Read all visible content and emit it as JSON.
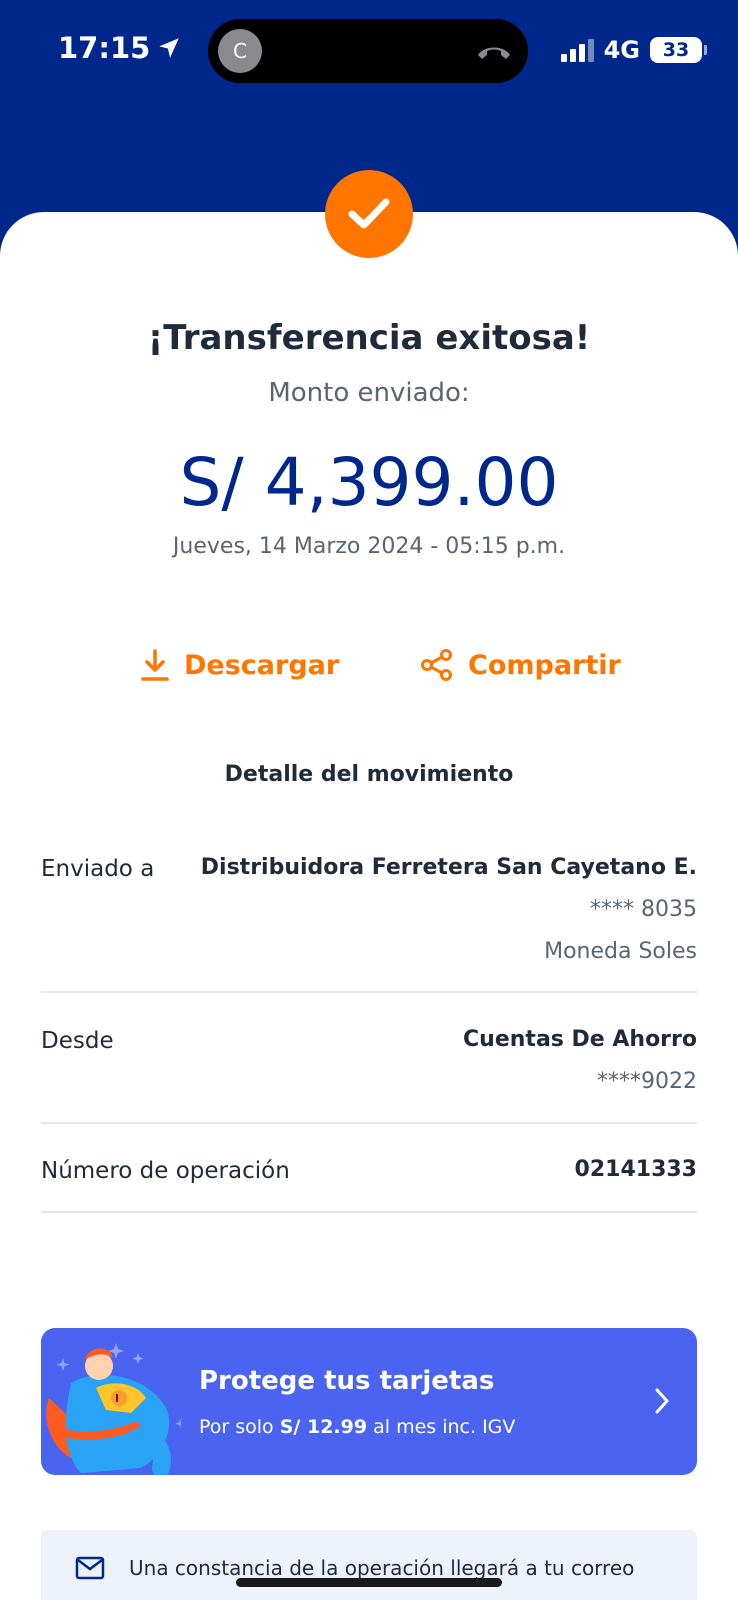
{
  "status_bar": {
    "time": "17:15",
    "caller_initial": "C",
    "network": "4G",
    "battery": "33"
  },
  "colors": {
    "brand_blue": "#00288c",
    "accent_orange": "#ff7500",
    "promo_blue": "#4a63f0"
  },
  "header": {
    "title": "¡Transferencia exitosa!",
    "subtitle": "Monto enviado:",
    "amount": "S/ 4,399.00",
    "date": "Jueves, 14 Marzo 2024 - 05:15 p.m."
  },
  "actions": {
    "download_label": "Descargar",
    "share_label": "Compartir"
  },
  "details": {
    "title": "Detalle del movimiento",
    "sent_to": {
      "label": "Enviado a",
      "name": "Distribuidora Ferretera San Cayetano E.",
      "account": "**** 8035",
      "currency": "Moneda Soles"
    },
    "from": {
      "label": "Desde",
      "account_type": "Cuentas De Ahorro",
      "account": "****9022"
    },
    "operation": {
      "label": "Número de operación",
      "number": "02141333"
    }
  },
  "promo": {
    "title": "Protege tus tarjetas",
    "sub_prefix": "Por solo",
    "sub_price": "S/ 12.99",
    "sub_suffix": "al mes inc. IGV"
  },
  "notice": {
    "text": "Una constancia de la operación llegará a tu correo"
  },
  "icons": {
    "success": "check-icon",
    "download": "download-icon",
    "share": "share-icon",
    "promo_arrow": "chevron-right-icon",
    "notice": "mail-icon",
    "location": "location-arrow-icon",
    "call": "phone-hangup-icon"
  }
}
